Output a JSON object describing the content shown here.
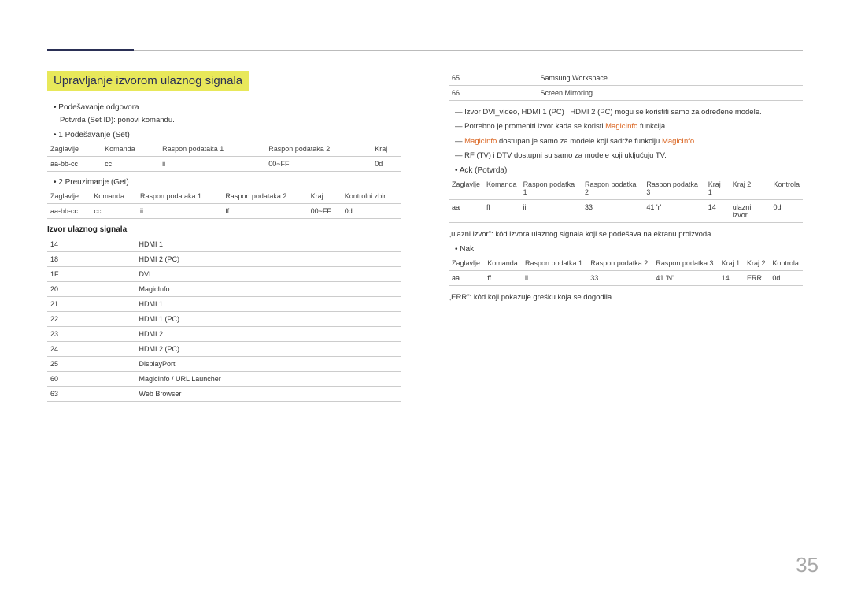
{
  "header": {
    "section_title": "Upravljanje izvorom ulaznog signala"
  },
  "left": {
    "bullets": {
      "b1": "Podešavanje odgovora",
      "b2": "Potvrda (Set ID): ponovi komandu.",
      "b3": "1 Podešavanje (Set)",
      "b4": "2 Preuzimanje (Get)"
    },
    "table_set": {
      "h1": "Zaglavlje",
      "h2": "Komanda",
      "h3": "Raspon podataka 1",
      "h4": "Raspon podataka 2",
      "h5": "Kraj",
      "r1c1": "aa-bb-cc",
      "r1c2": "cc",
      "r1c3": "ii",
      "r1c4": "00~FF",
      "r1c5": "0d"
    },
    "table_get": {
      "h1": "Zaglavlje",
      "h2": "Komanda",
      "h3": "Raspon podataka 1",
      "h4": "Raspon podataka 2",
      "h5": "Kraj",
      "h6": "Kontrolni zbir",
      "r1c1": "aa-bb-cc",
      "r1c2": "cc",
      "r1c3": "ii",
      "r1c4": "ff",
      "r1c5": "00~FF",
      "r1c6": "0d"
    },
    "list_heading": "Izvor ulaznog signala",
    "rows": [
      {
        "a": "14",
        "b": "HDMI 1"
      },
      {
        "a": "18",
        "b": "HDMI 2 (PC)"
      },
      {
        "a": "1F",
        "b": "DVI"
      },
      {
        "a": "20",
        "b": "MagicInfo"
      },
      {
        "a": "21",
        "b": "HDMI 1"
      },
      {
        "a": "22",
        "b": "HDMI 1 (PC)"
      },
      {
        "a": "23",
        "b": "HDMI 2"
      },
      {
        "a": "24",
        "b": "HDMI 2 (PC)"
      },
      {
        "a": "25",
        "b": "DisplayPort"
      },
      {
        "a": "60",
        "b": "MagicInfo / URL Launcher"
      },
      {
        "a": "63",
        "b": "Web Browser"
      }
    ]
  },
  "right": {
    "rows_cont": [
      {
        "a": "65",
        "b": "Samsung Workspace"
      },
      {
        "a": "66",
        "b": "Screen Mirroring"
      }
    ],
    "notes": [
      "Izvor DVI_video, HDMI 1 (PC) i HDMI 2 (PC) mogu se koristiti samo za određene modele.",
      "Potrebno je promeniti izvor kada se koristi MagicInfo funkcija.",
      "MagicInfo dostupan je samo za modele koji sadrže funkciju MagicInfo.",
      "RF (TV) i DTV dostupni su samo za modele koji uključuju TV."
    ],
    "bullet_ack": "• Ack (Potvrda)",
    "table_ack": {
      "h1": "Zaglavlje",
      "h2": "Komanda",
      "h3": "Raspon podatka 1",
      "h4": "Raspon podatka 2",
      "h5": "Raspon podatka 3",
      "h6": "Kraj 1",
      "h7": "Kraj 2",
      "h8": "Kontrola",
      "r1": [
        "aa",
        "ff",
        "ii",
        "33",
        "41 'r'",
        "14",
        "ulazni izvor",
        "0d"
      ]
    },
    "note_mid": "„ulazni izvor\": kôd izvora ulaznog signala koji se podešava na ekranu proizvoda.",
    "bullet_nak": "• Nak",
    "table_nak": {
      "h1": "Zaglavlje",
      "h2": "Komanda",
      "h3": "Raspon podatka 1",
      "h4": "Raspon podatka 2",
      "h5": "Raspon podatka 3",
      "h6": "Kraj 1",
      "h7": "Kraj 2",
      "h8": "Kontrola",
      "r1": [
        "aa",
        "ff",
        "ii",
        "33",
        "41 'N'",
        "14",
        "ERR",
        "0d"
      ]
    },
    "err_note": "„ERR\": kôd koji pokazuje grešku koja se dogodila."
  },
  "page_number": "35"
}
